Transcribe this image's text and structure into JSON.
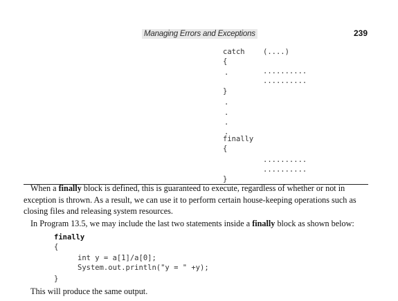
{
  "header": {
    "running_title": "Managing Errors and Exceptions",
    "page_number": "239"
  },
  "code_top": {
    "catch_kw": "catch",
    "catch_args": "(....)",
    "open_brace_1": "{",
    "dot_1": ".",
    "dots_a": "..........",
    "dots_b": "..........",
    "close_brace_1": "}",
    "dot_2": ".",
    "dot_3": ".",
    "dot_4": ".",
    "dot_5": ".",
    "finally_kw": "finally",
    "open_brace_2": "{",
    "dots_c": "..........",
    "dots_d": "..........",
    "close_brace_2": "}"
  },
  "paragraph1": {
    "pre": "When a ",
    "bold": "finally",
    "post": " block is defined, this is guaranteed to execute, regardless of whether or not in exception is thrown. As a result, we can use it to perform certain house-keeping operations such as closing files and releasing system resources."
  },
  "paragraph2": {
    "pre": "In Program 13.5, we may include the last two statements inside a ",
    "bold": "finally",
    "post": " block as shown below:"
  },
  "code_bottom": {
    "finally_kw": "finally",
    "open_brace": "{",
    "line1": "int y = a[1]/a[0];",
    "line2": "System.out.println(\"y = \" +y);",
    "close_brace": "}"
  },
  "paragraph3": "This will produce the same output."
}
